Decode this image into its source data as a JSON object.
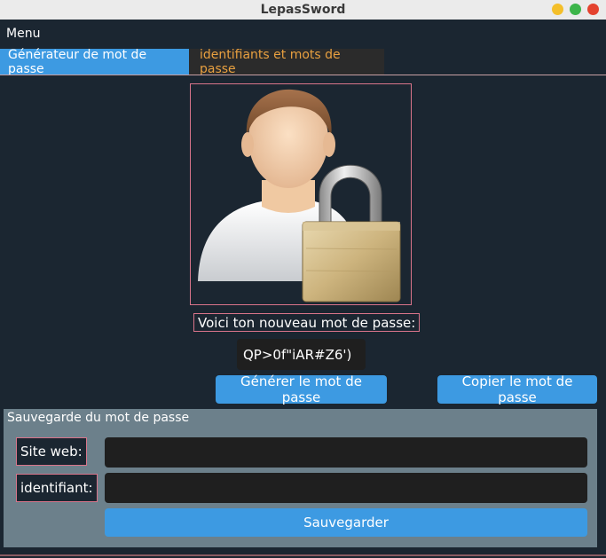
{
  "window": {
    "title": "LepasSword",
    "controls": {
      "minimize_color": "#f4bf2a",
      "maximize_color": "#3cb54a",
      "close_color": "#e4432f"
    }
  },
  "menubar": {
    "menu_label": "Menu"
  },
  "tabs": [
    {
      "label": "Générateur de mot de passe",
      "active": true
    },
    {
      "label": "identifiants et mots de passe",
      "active": false
    }
  ],
  "generator": {
    "image": "user-with-padlock-icon",
    "caption": "Voici ton nouveau mot de passe:",
    "password": "QP>0f\"iAR#Z6')",
    "generate_label": "Générer le mot de passe",
    "copy_label": "Copier le mot de passe"
  },
  "save_panel": {
    "title": "Sauvegarde du mot de passe",
    "website_label": "Site web:",
    "website_value": "",
    "identifier_label": "identifiant:",
    "identifier_value": "",
    "save_label": "Sauvegarder"
  },
  "colors": {
    "accent": "#3d9ae2",
    "background": "#1b2631",
    "inactive_tab_text": "#e8a040",
    "frame_border": "#d9748a",
    "panel_bg": "#6c808b"
  }
}
